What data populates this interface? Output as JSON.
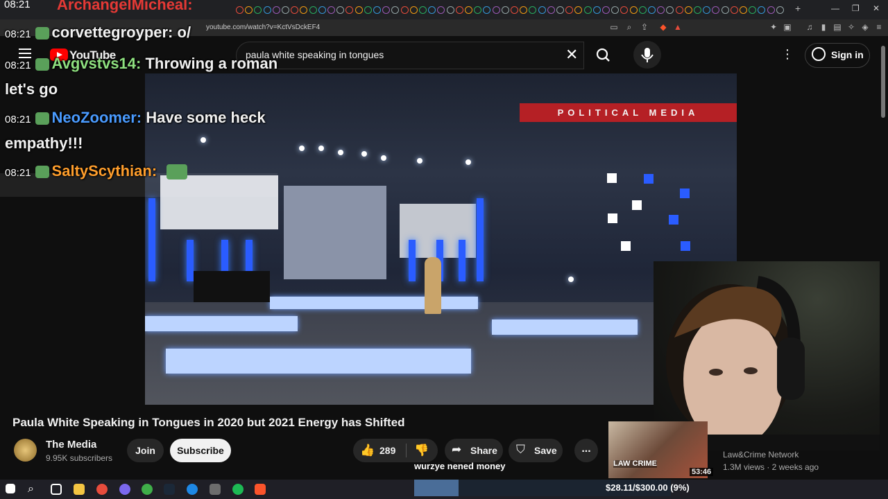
{
  "browser": {
    "url": "youtube.com/watch?v=KctVsDckEF4"
  },
  "youtube": {
    "logo_text": "YouTube",
    "search_query": "paula white speaking in tongues",
    "signin_label": "Sign in"
  },
  "video": {
    "overlay_banner": "POLITICAL MEDIA",
    "title": "Paula White Speaking in Tongues in 2020 but 2021 Energy has Shifted"
  },
  "channel": {
    "name": "The Media",
    "subscribers": "9.95K subscribers",
    "join_label": "Join",
    "subscribe_label": "Subscribe"
  },
  "actions": {
    "like_count": "289",
    "share_label": "Share",
    "save_label": "Save",
    "more_label": "..."
  },
  "chat": {
    "top_time": "08:21",
    "top_user": "ArchangelMicheal:",
    "messages": [
      {
        "time": "08:21",
        "user": "corvettegroyper:",
        "text": "o/",
        "color": "#f1f1f1"
      },
      {
        "time": "08:21",
        "user": "Avgvstvs14:",
        "text": "Throwing a roman let's go",
        "color": "#8ee07f"
      },
      {
        "time": "08:21",
        "user": "NeoZoomer:",
        "text": "Have some heck empathy!!!",
        "color": "#4a9bff"
      },
      {
        "time": "08:21",
        "user": "SaltyScythian:",
        "text": "",
        "color": "#ff9e2c"
      }
    ]
  },
  "recommendation": {
    "channel": "Law&Crime Network",
    "meta": "1.3M views · 2 weeks ago",
    "duration": "53:46",
    "logo": "LAW CRIME"
  },
  "stream_overlay": {
    "tts_text": "wurzye nened money",
    "goal_text": "$28.11/$300.00 (9%)",
    "goal_fraction": 0.0937
  }
}
